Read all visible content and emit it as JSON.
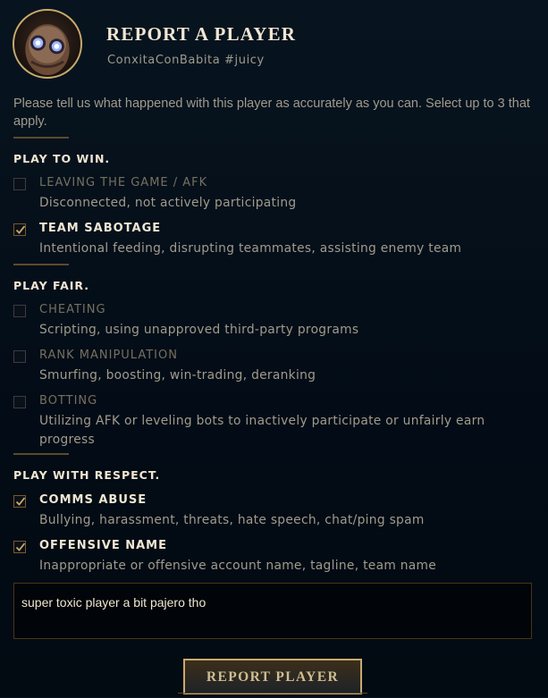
{
  "header": {
    "title": "REPORT A PLAYER",
    "player_name": "ConxitaConBabita #juicy",
    "avatar_icon": "robot-champion-icon"
  },
  "intro_text": "Please tell us what happened with this player as accurately as you can. Select up to 3 that apply.",
  "sections": [
    {
      "title": "PLAY TO WIN.",
      "items": [
        {
          "label": "LEAVING THE GAME / AFK",
          "description": "Disconnected, not actively participating",
          "checked": false
        },
        {
          "label": "TEAM SABOTAGE",
          "description": "Intentional feeding, disrupting teammates, assisting enemy team",
          "checked": true
        }
      ]
    },
    {
      "title": "PLAY FAIR.",
      "items": [
        {
          "label": "CHEATING",
          "description": "Scripting, using unapproved third-party programs",
          "checked": false
        },
        {
          "label": "RANK MANIPULATION",
          "description": "Smurfing, boosting, win-trading, deranking",
          "checked": false
        },
        {
          "label": "BOTTING",
          "description": "Utilizing AFK or leveling bots to inactively participate or unfairly earn progress",
          "checked": false
        }
      ]
    },
    {
      "title": "PLAY WITH RESPECT.",
      "items": [
        {
          "label": "COMMS ABUSE",
          "description": "Bullying, harassment, threats, hate speech, chat/ping spam",
          "checked": true
        },
        {
          "label": "OFFENSIVE NAME",
          "description": "Inappropriate or offensive account name, tagline, team name",
          "checked": true
        }
      ]
    }
  ],
  "comment": {
    "value": "super toxic player a bit pajero tho"
  },
  "report_button_label": "REPORT PLAYER",
  "colors": {
    "gold": "#c8aa6e",
    "text": "#a09b8c",
    "bright": "#f0e6d2",
    "background": "#010a13"
  }
}
